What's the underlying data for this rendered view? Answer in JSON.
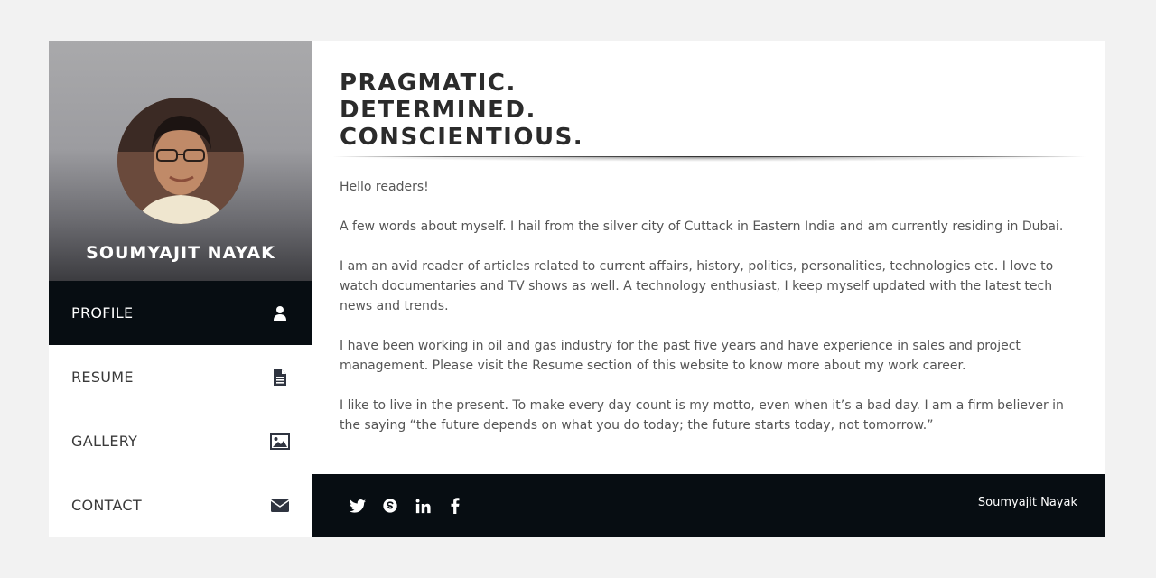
{
  "profile": {
    "name": "SOUMYAJIT NAYAK"
  },
  "nav": {
    "items": [
      {
        "label": "PROFILE",
        "icon": "user-icon",
        "active": true
      },
      {
        "label": "RESUME",
        "icon": "document-icon",
        "active": false
      },
      {
        "label": "GALLERY",
        "icon": "image-icon",
        "active": false
      },
      {
        "label": "CONTACT",
        "icon": "envelope-icon",
        "active": false
      }
    ]
  },
  "main": {
    "headline": [
      "PRAGMATIC.",
      "DETERMINED.",
      "CONSCIENTIOUS."
    ],
    "paragraphs": [
      "Hello readers!",
      "A few words about myself. I hail from the silver city of Cuttack in Eastern India and am currently residing in Dubai.",
      "I am an avid reader of articles related to current affairs, history, politics, personalities, technologies etc. I love to watch documentaries and TV shows as well. A technology enthusiast, I keep myself updated with the latest tech news and trends.",
      "I have been working in oil and gas industry for the past five years and have experience in sales and project management. Please visit the Resume section of this website to know more about my work career.",
      "I like to live in the present. To make every day count is my motto, even when it’s a bad day. I am a firm believer in the saying “the future depends on what you do today; the future starts today, not tomorrow.”"
    ]
  },
  "footer": {
    "social": [
      "twitter-icon",
      "skype-icon",
      "linkedin-icon",
      "facebook-icon"
    ],
    "name": "Soumyajit Nayak"
  },
  "colors": {
    "page_bg": "#f2f2f2",
    "dark": "#070d12",
    "heading": "#2b2b2b",
    "body_text": "#555555",
    "nav_icon": "#2f3440"
  }
}
